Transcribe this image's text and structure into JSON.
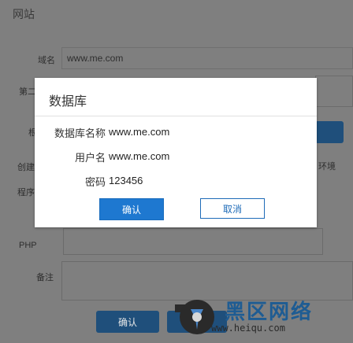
{
  "background": {
    "title": "网站",
    "domain_label": "域名",
    "domain_value": "www.me.com",
    "second_label": "第二",
    "root_label": "根",
    "create_label": "创建",
    "program_label": "程序",
    "php_label": "PHP",
    "env_label": "环境",
    "remark_label": "备注",
    "confirm_label": "确认"
  },
  "dialog": {
    "title": "数据库",
    "fields": [
      {
        "label": "数据库名称",
        "value": "www.me.com"
      },
      {
        "label": "用户名",
        "value": "www.me.com"
      },
      {
        "label": "密码",
        "value": "123456"
      }
    ],
    "ok_label": "确认",
    "cancel_label": "取消"
  },
  "watermark": {
    "text": "黑区网络",
    "url": "www.heiqu.com"
  }
}
